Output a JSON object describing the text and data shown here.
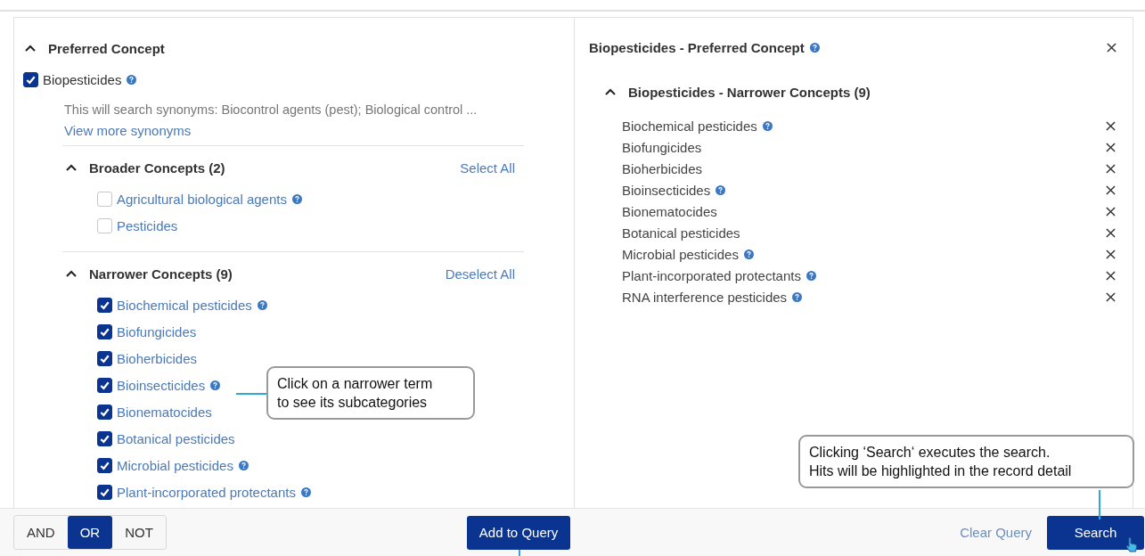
{
  "concept_panel": {
    "preferred": {
      "title": "Preferred Concept",
      "expanded": true,
      "term": {
        "label": "Biopesticides",
        "checked": true,
        "info": true
      },
      "synonyms": "This will search synonyms: Biocontrol agents (pest); Biological control ...",
      "more_link": "View more synonyms"
    },
    "groups": [
      {
        "title": "Broader Concepts (2)",
        "expanded": true,
        "action": "Select All",
        "items": [
          {
            "label": "Agricultural biological agents",
            "checked": false,
            "info": true
          },
          {
            "label": "Pesticides",
            "checked": false,
            "info": false
          }
        ]
      },
      {
        "title": "Narrower Concepts (9)",
        "expanded": true,
        "action": "Deselect All",
        "items": [
          {
            "label": "Biochemical pesticides",
            "checked": true,
            "info": true
          },
          {
            "label": "Biofungicides",
            "checked": true,
            "info": false
          },
          {
            "label": "Bioherbicides",
            "checked": true,
            "info": false
          },
          {
            "label": "Bioinsecticides",
            "checked": true,
            "info": true
          },
          {
            "label": "Bionematocides",
            "checked": true,
            "info": false
          },
          {
            "label": "Botanical pesticides",
            "checked": true,
            "info": false
          },
          {
            "label": "Microbial pesticides",
            "checked": true,
            "info": true
          },
          {
            "label": "Plant-incorporated protectants",
            "checked": true,
            "info": true
          }
        ]
      }
    ]
  },
  "query_panel": {
    "title": "Biopesticides - Preferred Concept",
    "info": true,
    "section": {
      "title": "Biopesticides - Narrower Concepts (9)",
      "expanded": true,
      "items": [
        {
          "label": "Biochemical pesticides",
          "info": true
        },
        {
          "label": "Biofungicides",
          "info": false
        },
        {
          "label": "Bioherbicides",
          "info": false
        },
        {
          "label": "Bioinsecticides",
          "info": true
        },
        {
          "label": "Bionematocides",
          "info": false
        },
        {
          "label": "Botanical pesticides",
          "info": false
        },
        {
          "label": "Microbial pesticides",
          "info": true
        },
        {
          "label": "Plant-incorporated protectants",
          "info": true
        },
        {
          "label": "RNA interference pesticides",
          "info": true
        }
      ]
    }
  },
  "operators": [
    {
      "label": "AND",
      "selected": false
    },
    {
      "label": "OR",
      "selected": true
    },
    {
      "label": "NOT",
      "selected": false
    }
  ],
  "add_button": "Add to Query",
  "clear_link": "Clear Query",
  "search_button": "Search",
  "callouts": [
    {
      "text": "Click on a narrower term\nto see its subcategories"
    },
    {
      "text": "Clicking ‘Search‘ executes the search.\nHits will be highlighted in the record detail"
    }
  ]
}
